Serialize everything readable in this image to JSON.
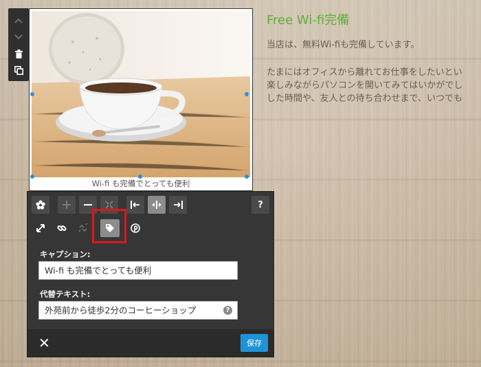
{
  "article": {
    "title": "Free Wi-fi完備",
    "lead": "当店は、無料Wi-fiも完備しています。",
    "body_lines": [
      "たまにはオフィスから離れてお仕事をしたいとい",
      "楽しみながらパソコンを開いてみてはいかがでし",
      "した時間や、友人との待ち合わせまで、いつでも"
    ]
  },
  "image": {
    "caption": "Wi-fi も完備でとっても便利"
  },
  "panel": {
    "help_label": "?",
    "caption_label": "キャプション:",
    "caption_value": "Wi-fi も完備でとっても便利",
    "alt_label": "代替テキスト:",
    "alt_value": "外苑前から徒歩2分のコーヒーショップ",
    "alt_help": "?",
    "close_label": "✕",
    "save_label": "保存"
  },
  "colors": {
    "accent": "#1e94d8",
    "title_green": "#5fae3a",
    "highlight_red": "#e2141a"
  },
  "icons": {
    "move_up": "chevron-up-icon",
    "move_down": "chevron-down-icon",
    "delete": "trash-icon",
    "duplicate": "copy-icon",
    "settings": "flower-icon",
    "zoom_in": "plus-icon",
    "zoom_out": "minus-icon",
    "crop": "shrink-icon",
    "align_left": "align-left-icon",
    "align_center": "align-center-icon",
    "align_right": "align-right-icon",
    "resize": "resize-icon",
    "link": "link-icon",
    "unlink": "unlink-icon",
    "tag": "tag-icon",
    "pinterest": "pinterest-icon"
  }
}
